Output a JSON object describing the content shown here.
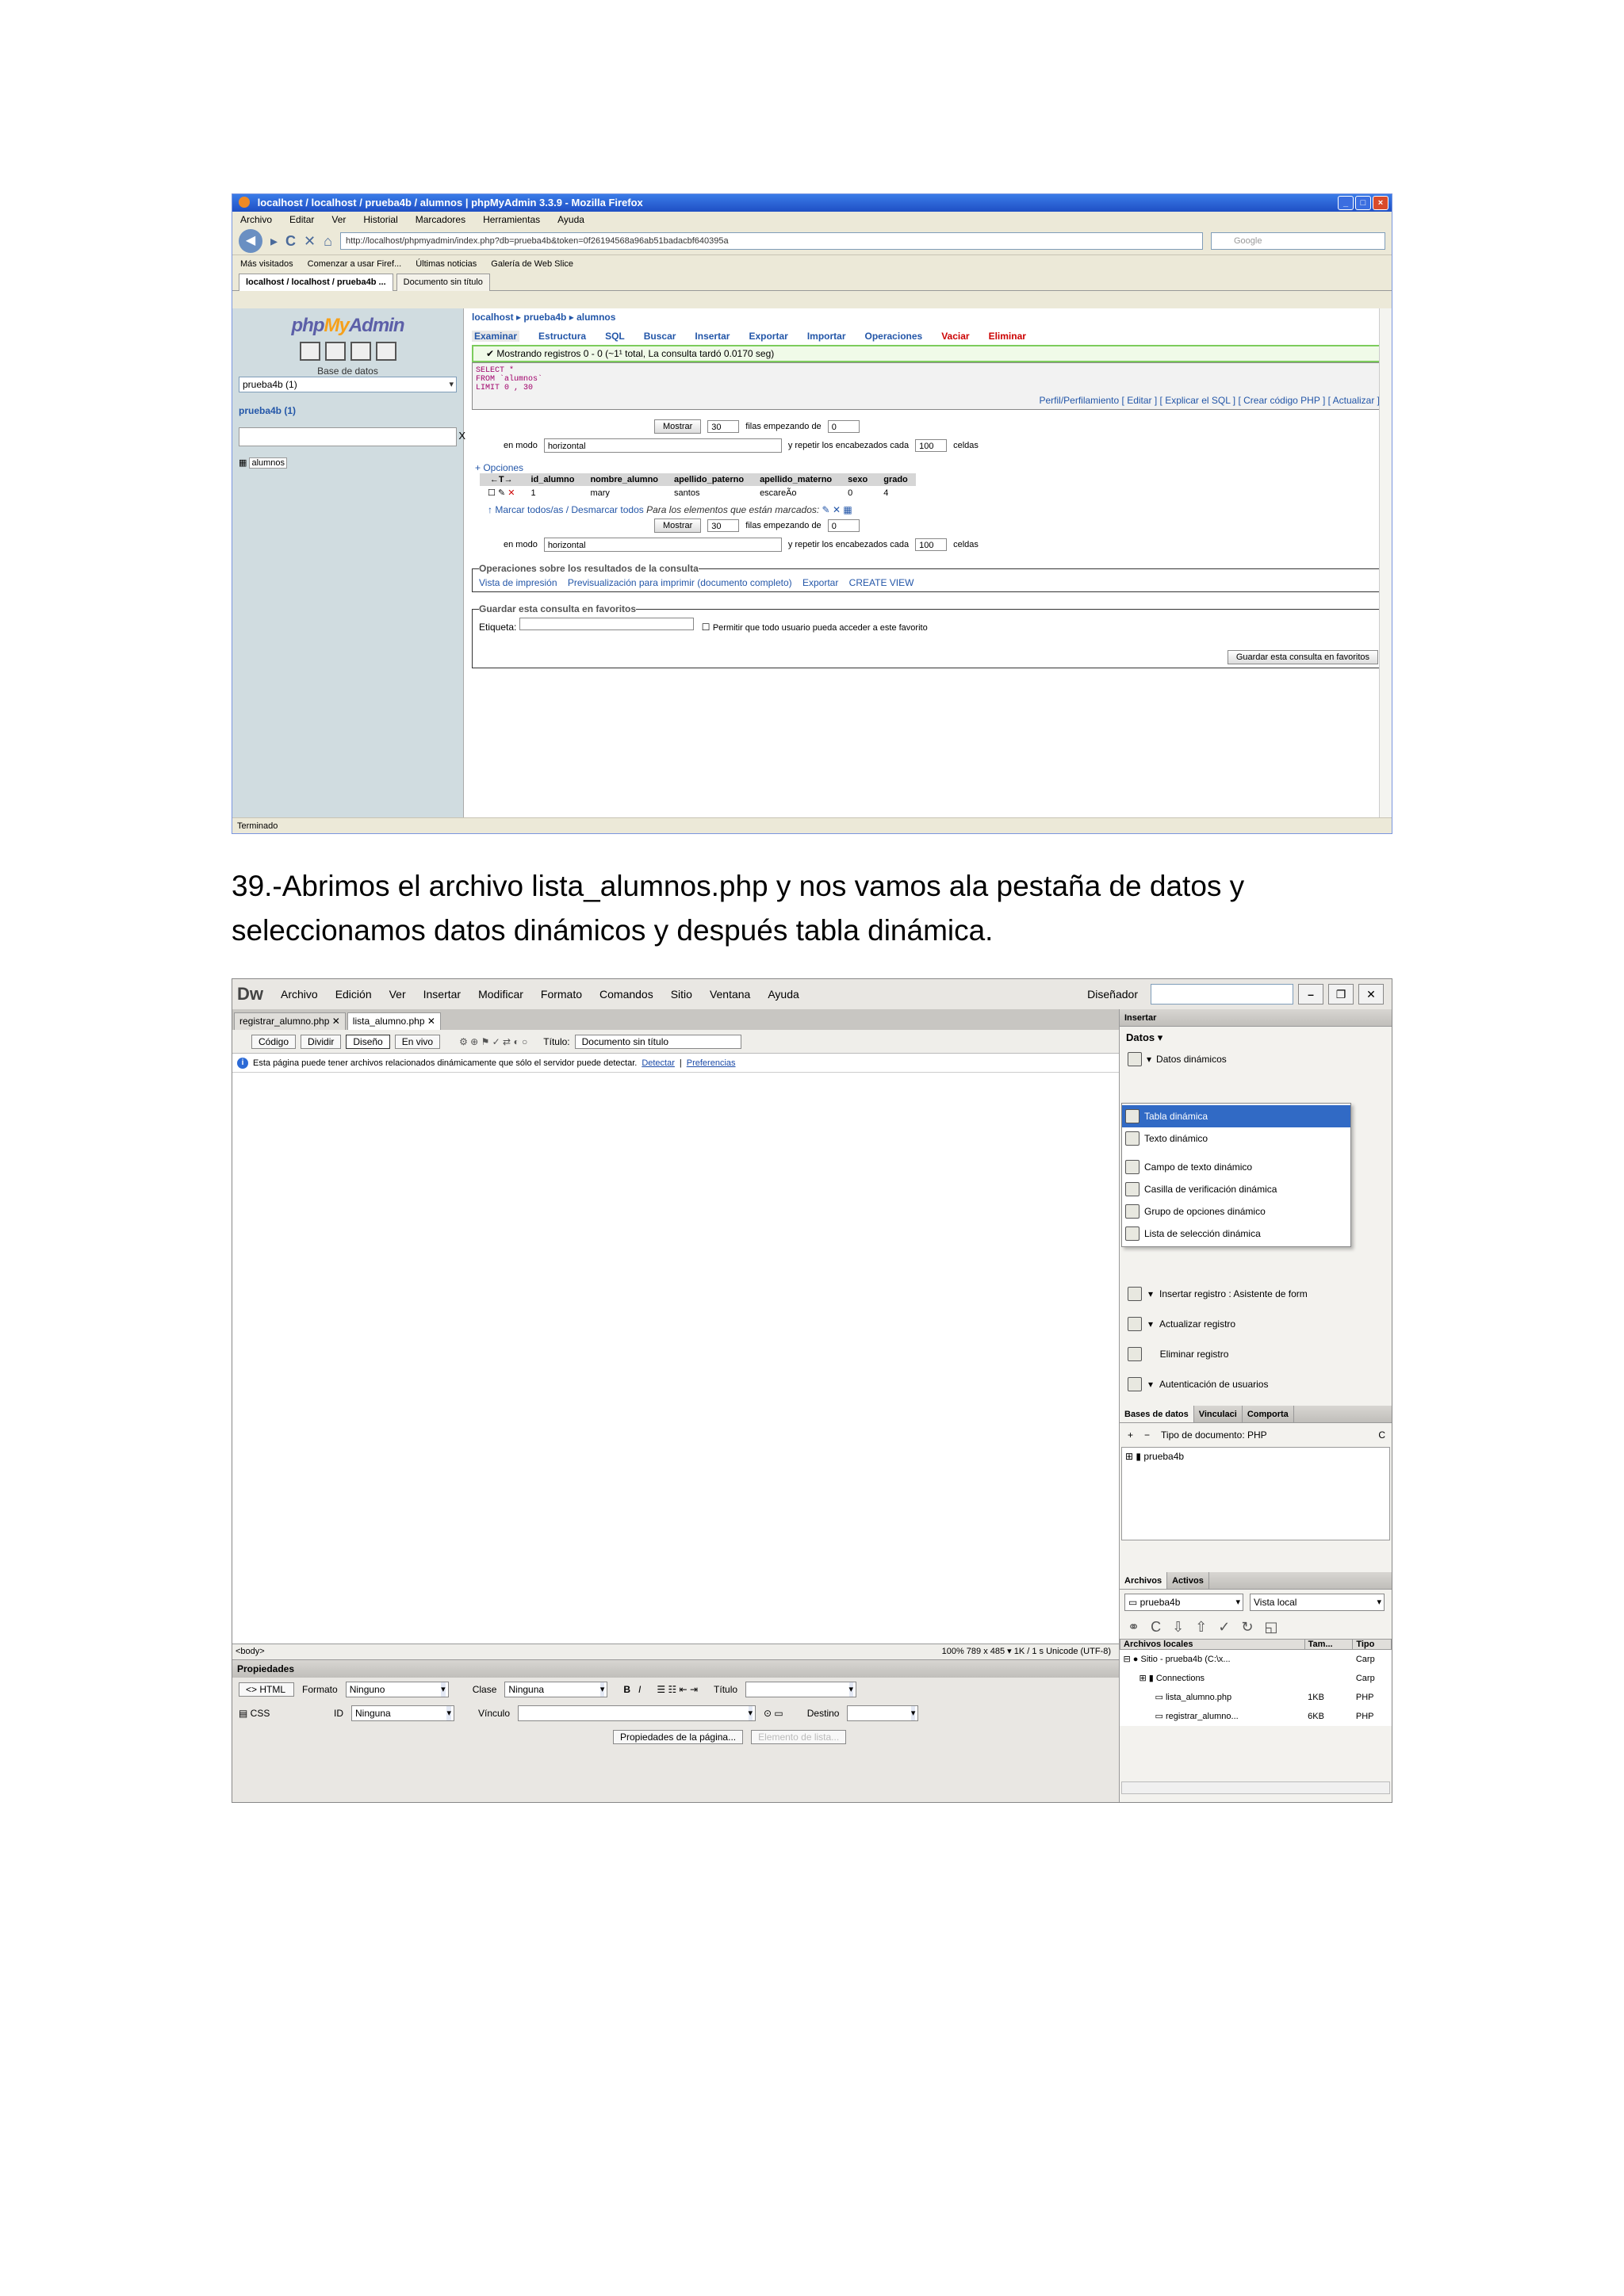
{
  "browser": {
    "title": "localhost / localhost / prueba4b / alumnos | phpMyAdmin 3.3.9 - Mozilla Firefox",
    "menu": [
      "Archivo",
      "Editar",
      "Ver",
      "Historial",
      "Marcadores",
      "Herramientas",
      "Ayuda"
    ],
    "url": "http://localhost/phpmyadmin/index.php?db=prueba4b&token=0f26194568a96ab51badacbf640395a",
    "search_placeholder": "Google",
    "bookmarks": [
      "Más visitados",
      "Comenzar a usar Firef...",
      "Últimas noticias",
      "Galería de Web Slice"
    ],
    "tabs": [
      "localhost / localhost / prueba4b ...",
      "Documento sin título"
    ],
    "status": "Terminado"
  },
  "pma": {
    "logo_php": "php",
    "logo_my": "My",
    "logo_admin": "Admin",
    "db_label": "Base de datos",
    "db_select": "prueba4b (1)",
    "db_name": "prueba4b (1)",
    "table_link": "alumnos",
    "crumb": "localhost ▸ prueba4b ▸ alumnos",
    "tabs": [
      "Examinar",
      "Estructura",
      "SQL",
      "Buscar",
      "Insertar",
      "Exportar",
      "Importar",
      "Operaciones",
      "Vaciar"
    ],
    "tab_delete": "Eliminar",
    "ok_msg": "Mostrando registros 0 - 0 (~1¹ total, La consulta tardó 0.0170 seg)",
    "sql_lines": [
      "SELECT *",
      "FROM `alumnos`",
      "LIMIT 0 , 30"
    ],
    "sql_links": "Perfil/Perfilamiento [ Editar ] [ Explicar el SQL ] [ Crear código PHP ] [ Actualizar ]",
    "show_btn": "Mostrar",
    "rows_value": "30",
    "rows_label": "filas empezando de",
    "start_value": "0",
    "mode_label": "en modo",
    "mode_value": "horizontal",
    "repeat_label": "y repetir los encabezados cada",
    "repeat_value": "100",
    "cells_label": "celdas",
    "options": "+ Opciones",
    "headers": [
      "id_alumno",
      "nombre_alumno",
      "apellido_paterno",
      "apellido_materno",
      "sexo",
      "grado"
    ],
    "row": [
      "1",
      "mary",
      "santos",
      "escareÃo",
      "0",
      "4"
    ],
    "mark_all": "Marcar todos/as / Desmarcar todos",
    "mark_note": "Para los elementos que están marcados:",
    "ops_legend": "Operaciones sobre los resultados de la consulta",
    "ops": [
      "Vista de impresión",
      "Previsualización para imprimir (documento completo)",
      "Exportar",
      "CREATE VIEW"
    ],
    "fav_legend": "Guardar esta consulta en favoritos",
    "fav_label": "Etiqueta:",
    "fav_check": "Permitir que todo usuario pueda acceder a este favorito",
    "fav_btn": "Guardar esta consulta en favoritos"
  },
  "caption": {
    "line1": "39.-Abrimos el archivo lista_alumnos.php y nos vamos ala pestaña de datos y",
    "line2": "seleccionamos datos dinámicos y después tabla dinámica."
  },
  "dw": {
    "logo": "Dw",
    "menu": [
      "Archivo",
      "Edición",
      "Ver",
      "Insertar",
      "Modificar",
      "Formato",
      "Comandos",
      "Sitio",
      "Ventana",
      "Ayuda"
    ],
    "layout": "Diseñador",
    "doc_tabs": [
      "registrar_alumno.php",
      "lista_alumno.php"
    ],
    "views": [
      "Código",
      "Dividir",
      "Diseño",
      "En vivo"
    ],
    "title_label": "Título:",
    "title_value": "Documento sin título",
    "info": "Esta página puede tener archivos relacionados dinámicamente que sólo el servidor puede detectar.",
    "info_link1": "Detectar",
    "info_link2": "Preferencias",
    "tag": "<body>",
    "status_right": "100%   789 x 485 ▾  1K / 1 s  Unicode (UTF-8)",
    "props_title": "Propiedades",
    "html_btn": "HTML",
    "css_btn": "CSS",
    "formato_label": "Formato",
    "formato_value": "Ninguno",
    "clase_label": "Clase",
    "clase_value": "Ninguna",
    "id_label": "ID",
    "id_value": "Ninguna",
    "vinculo_label": "Vínculo",
    "titulo_label": "Título",
    "destino_label": "Destino",
    "page_props_btn": "Propiedades de la página...",
    "list_item_btn": "Elemento de lista...",
    "insert_panel": "Insertar",
    "datos_label": "Datos",
    "dyn_data": "Datos dinámicos",
    "dd_items": [
      "Tabla dinámica",
      "Texto dinámico"
    ],
    "dd_items2": [
      "Campo de texto dinámico",
      "Casilla de verificación dinámica",
      "Grupo de opciones dinámico",
      "Lista de selección dinámica"
    ],
    "commands": [
      "Insertar registro : Asistente de form",
      "Actualizar registro",
      "Eliminar registro",
      "Autenticación de usuarios"
    ],
    "db_tabs": [
      "Bases de datos",
      "Vinculaci",
      "Comporta"
    ],
    "doc_type": "Tipo de documento: PHP",
    "db_tree_item": "prueba4b",
    "files_tabs": [
      "Archivos",
      "Activos"
    ],
    "site_select": "prueba4b",
    "view_select": "Vista local",
    "files_header": [
      "Archivos locales",
      "Tam...",
      "Tipo"
    ],
    "files": [
      {
        "name": "Sitio - prueba4b (C:\\x...",
        "size": "",
        "type": "Carp"
      },
      {
        "name": "Connections",
        "size": "",
        "type": "Carp"
      },
      {
        "name": "lista_alumno.php",
        "size": "1KB",
        "type": "PHP"
      },
      {
        "name": "registrar_alumno...",
        "size": "6KB",
        "type": "PHP"
      }
    ]
  }
}
